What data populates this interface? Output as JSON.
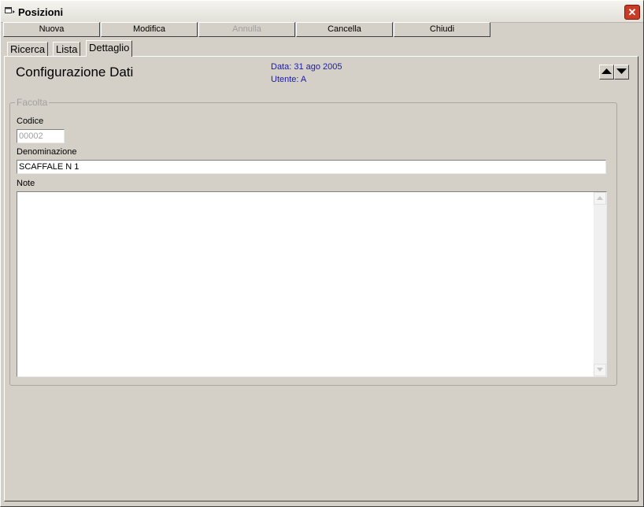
{
  "window": {
    "title": "Posizioni",
    "close_symbol": "✕"
  },
  "toolbar": {
    "buttons": [
      {
        "label": "Nuova",
        "enabled": true
      },
      {
        "label": "Modifica",
        "enabled": true
      },
      {
        "label": "Annulla",
        "enabled": false
      },
      {
        "label": "Cancella",
        "enabled": true
      },
      {
        "label": "Chiudi",
        "enabled": true
      }
    ]
  },
  "tabs": [
    {
      "label": "Ricerca",
      "active": false
    },
    {
      "label": "Lista",
      "active": false
    },
    {
      "label": "Dettaglio",
      "active": true
    }
  ],
  "header": {
    "title": "Configurazione Dati",
    "date_text": "Data: 31 ago 2005",
    "user_text": "Utente: A"
  },
  "group": {
    "legend": "Facolta",
    "fields": {
      "codice": {
        "label": "Codice",
        "value": "00002"
      },
      "denominazione": {
        "label": "Denominazione",
        "value": "SCAFFALE N 1"
      },
      "note": {
        "label": "Note",
        "value": ""
      }
    }
  },
  "icons": {
    "window": "window-icon",
    "prev": "arrow-up-icon",
    "next": "arrow-down-icon"
  }
}
